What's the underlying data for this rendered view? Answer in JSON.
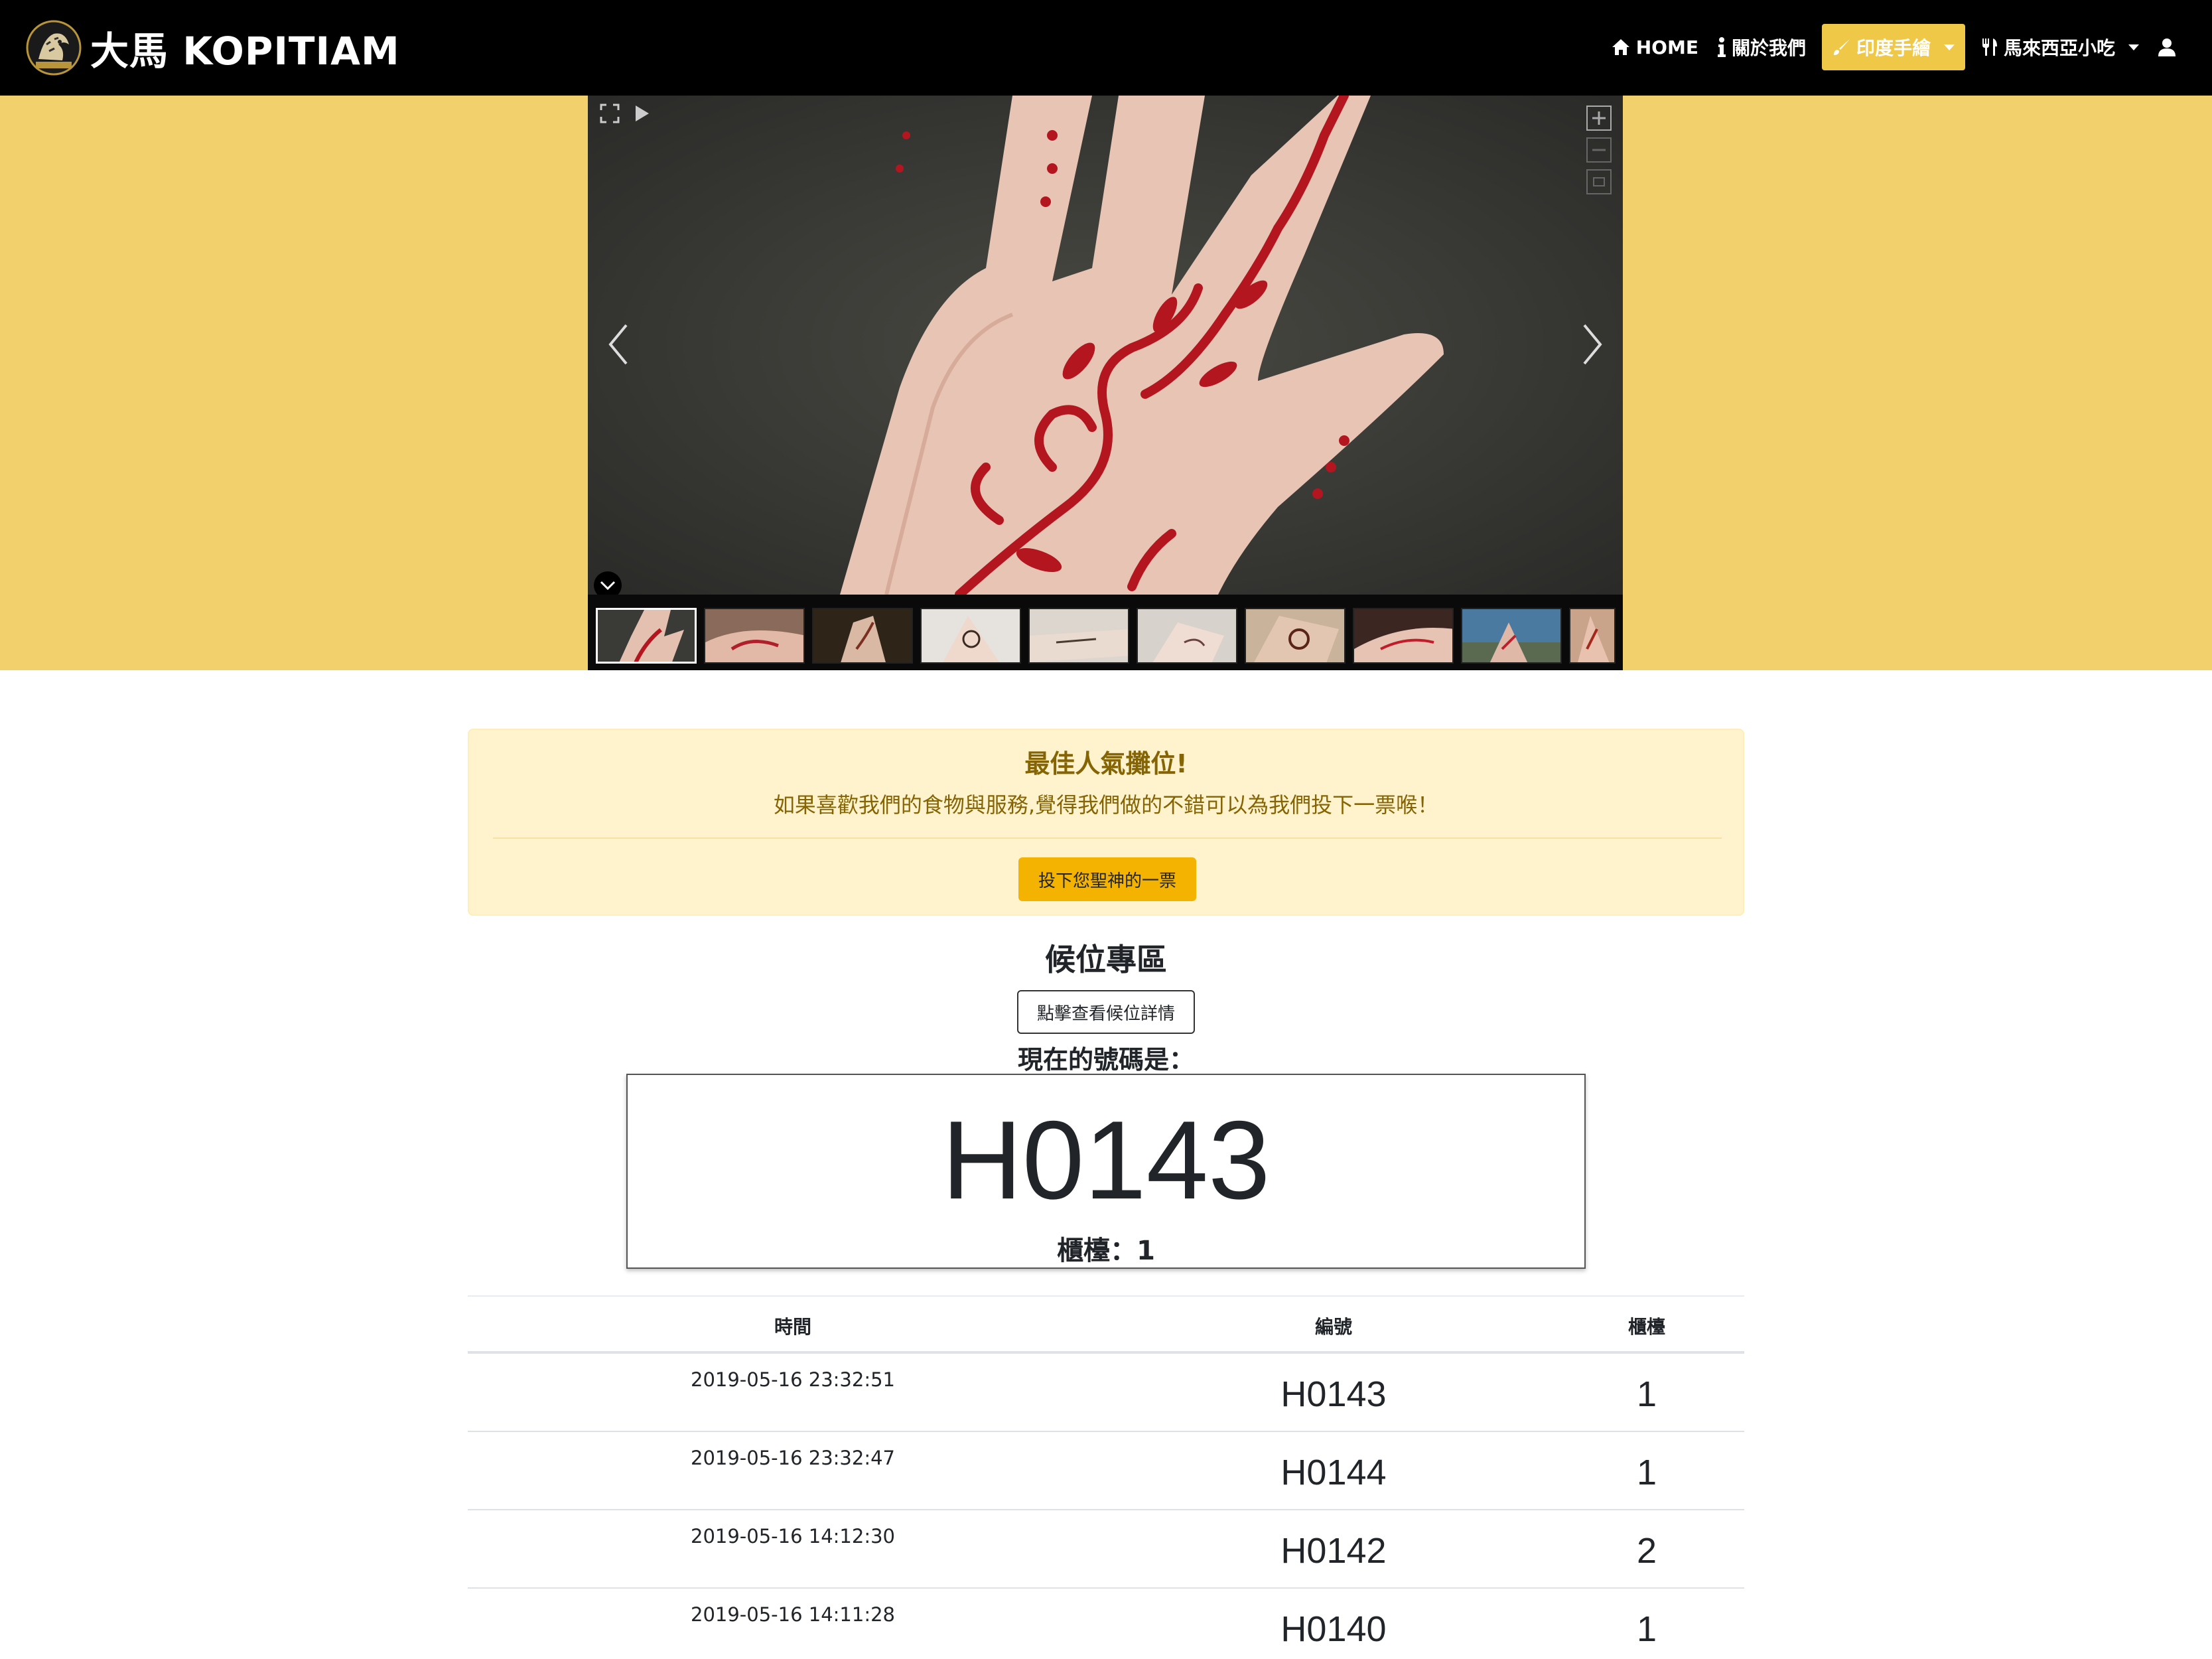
{
  "navbar": {
    "brand": "大馬 KOPITIAM",
    "items": [
      {
        "icon": "home-icon",
        "label": "HOME"
      },
      {
        "icon": "info-icon",
        "label": "關於我們"
      },
      {
        "icon": "brush-icon",
        "label": "印度手繪",
        "active": true,
        "dropdown": true
      },
      {
        "icon": "utensils-icon",
        "label": "馬來西亞小吃",
        "dropdown": true
      },
      {
        "icon": "user-icon",
        "label": ""
      }
    ]
  },
  "gallery": {
    "thumbnail_count": 10,
    "active_index": 0
  },
  "vote": {
    "title": "最佳人氣攤位!",
    "description": "如果喜歡我們的食物與服務,覺得我們做的不錯可以為我們投下一票喉！",
    "button_label": "投下您聖神的一票"
  },
  "queue": {
    "title": "候位專區",
    "details_button": "點擊查看候位詳情",
    "current_label": "現在的號碼是：",
    "current_number": "H0143",
    "counter_text": "櫃檯：1"
  },
  "table": {
    "headers": {
      "time": "時間",
      "number": "編號",
      "counter": "櫃檯"
    },
    "rows": [
      {
        "time": "2019-05-16 23:32:51",
        "number": "H0143",
        "counter": "1"
      },
      {
        "time": "2019-05-16 23:32:47",
        "number": "H0144",
        "counter": "1"
      },
      {
        "time": "2019-05-16 14:12:30",
        "number": "H0142",
        "counter": "2"
      },
      {
        "time": "2019-05-16 14:11:28",
        "number": "H0140",
        "counter": "1"
      }
    ]
  },
  "colors": {
    "navbar_bg": "#000000",
    "hero_bg": "#f2d06b",
    "active_nav": "#f0c847",
    "alert_bg": "#fff3cd",
    "alert_text": "#856404",
    "vote_button": "#f5b301"
  }
}
